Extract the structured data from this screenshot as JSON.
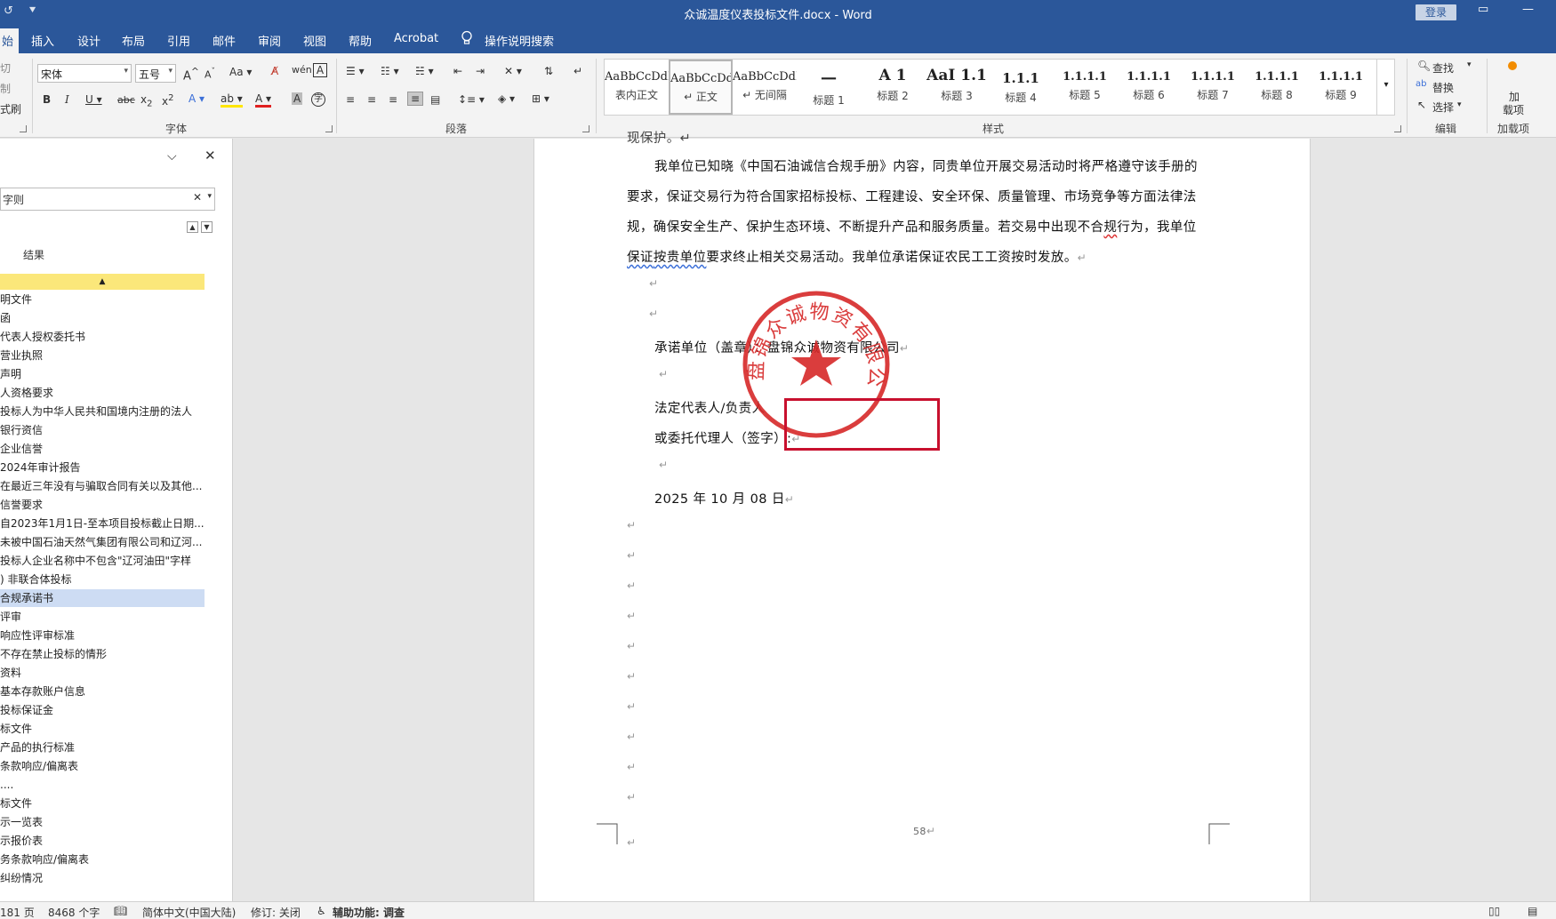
{
  "titlebar": {
    "doc_title": "众诚温度仪表投标文件.docx  -  Word",
    "login_label": "登录"
  },
  "tabs": [
    {
      "label": "始"
    },
    {
      "label": "插入"
    },
    {
      "label": "设计"
    },
    {
      "label": "布局"
    },
    {
      "label": "引用"
    },
    {
      "label": "邮件"
    },
    {
      "label": "审阅"
    },
    {
      "label": "视图"
    },
    {
      "label": "帮助"
    },
    {
      "label": "Acrobat"
    },
    {
      "label": "操作说明搜索"
    }
  ],
  "ribbon": {
    "clipboard": {
      "cut": "切",
      "copy": "制",
      "painter": "式刷"
    },
    "font": {
      "name": "宋体",
      "size": "五号",
      "group_label": "字体"
    },
    "paragraph": {
      "group_label": "段落"
    },
    "styles": {
      "group_label": "样式",
      "items": [
        {
          "preview": "AaBbCcDdI",
          "name": "表内正文"
        },
        {
          "preview": "AaBbCcDdI",
          "name": "↵ 正文"
        },
        {
          "preview": "AaBbCcDdI",
          "name": "↵ 无间隔"
        },
        {
          "preview": "一",
          "name": "标题 1"
        },
        {
          "preview": "A 1",
          "name": "标题 2"
        },
        {
          "preview": "AaI 1.1",
          "name": "标题 3"
        },
        {
          "preview": "1.1.1",
          "name": "标题 4"
        },
        {
          "preview": "1.1.1.1",
          "name": "标题 5"
        },
        {
          "preview": "1.1.1.1",
          "name": "标题 6"
        },
        {
          "preview": "1.1.1.1",
          "name": "标题 7"
        },
        {
          "preview": "1.1.1.1",
          "name": "标题 8"
        },
        {
          "preview": "1.1.1.1",
          "name": "标题 9"
        }
      ]
    },
    "editing": {
      "find": "查找",
      "replace": "替换",
      "select": "选择",
      "group_label": "编辑"
    },
    "addins": {
      "label1": "加",
      "label2": "载项",
      "group_label": "加载项"
    }
  },
  "navpane": {
    "search_value": "字则",
    "results_label": "结果",
    "items": [
      "明文件",
      "函",
      "代表人授权委托书",
      "营业执照",
      "声明",
      "人资格要求",
      "投标人为中华人民共和国境内注册的法人",
      "银行资信",
      "企业信誉",
      "2024年审计报告",
      "在最近三年没有与骗取合同有关以及其他...",
      "信誉要求",
      "自2023年1月1日-至本项目投标截止日期...",
      "未被中国石油天然气集团有限公司和辽河...",
      "投标人企业名称中不包含\"辽河油田\"字样",
      ") 非联合体投标",
      " 合规承诺书",
      "评审",
      "响应性评审标准",
      "不存在禁止投标的情形",
      "资料",
      "基本存款账户信息",
      "投标保证金",
      "标文件",
      "产品的执行标准",
      "条款响应/偏离表",
      "....",
      "标文件",
      "示一览表",
      "示报价表",
      "务条款响应/偏离表",
      "纠纷情况"
    ],
    "selected_index": 16
  },
  "document": {
    "top_fragment": "现保护。↵",
    "para1_line1": "我单位已知晓《中国石油诚信合规手册》内容，同贵单位开展交易活动时将严格遵守该手册的",
    "para1_line2": "要求，保证交易行为符合国家招标投标、工程建设、安全环保、质量管理、市场竞争等方面法律法",
    "para1_line3_a": "规，确保安全生产、保护生态环境、不断提升产品和服务质量。若交易中出现不合",
    "para1_line3_b": "规",
    "para1_line3_c": "行为，我单位",
    "para1_line4_a": "保证",
    "para1_line4_b": "按贵单位",
    "para1_line4_c": "要求终止相关交易活动。我单位承诺保证农民工工资按时发放。",
    "promisor": "承诺单位（盖章）：盘锦众诚物资有限公司",
    "legal_rep": "法定代表人/负责人",
    "agent": "或委托代理人（签字）:",
    "date": "2025 年 10 月 08 日",
    "page_number": "58",
    "para_mark": "↵",
    "seal_text": "盘锦众诚物资有限公司"
  },
  "statusbar": {
    "pages": "181 页",
    "words": "8468 个字",
    "language": "简体中文(中国大陆)",
    "track_changes": "修订: 关闭",
    "accessibility": "辅助功能: 调查"
  },
  "colors": {
    "word_blue": "#2b579a",
    "seal_red": "#d62828",
    "box_red": "#c8102e",
    "nav_highlight": "#cddcf3",
    "nav_collapse": "#fbe77a"
  }
}
